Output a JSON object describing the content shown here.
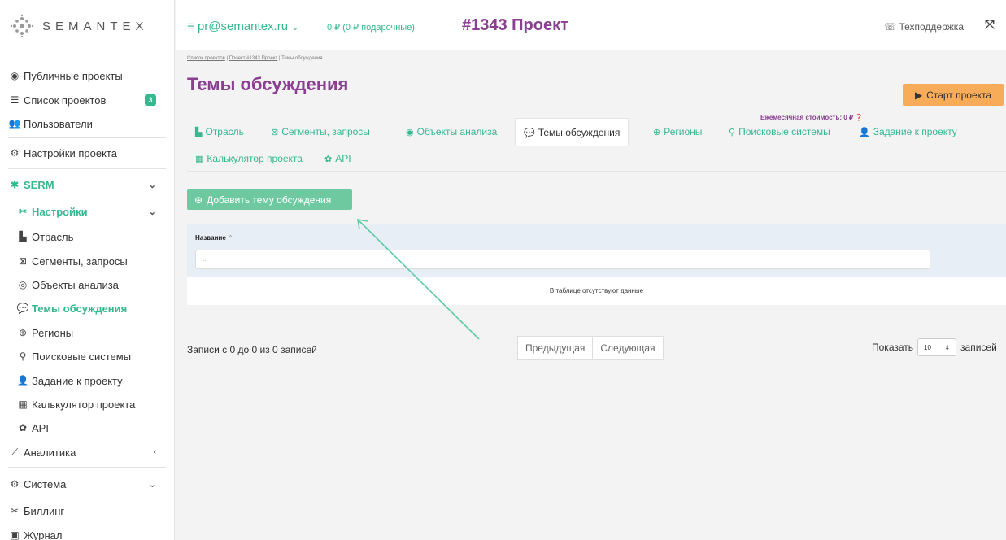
{
  "brand": {
    "name": "SEMANTEX"
  },
  "sidebar": {
    "items": [
      {
        "label": "Публичные проекты",
        "icon": "eye-icon"
      },
      {
        "label": "Список проектов",
        "icon": "list-icon",
        "badge": "3"
      },
      {
        "label": "Пользователи",
        "icon": "users-icon"
      },
      {
        "label": "Настройки проекта",
        "icon": "cogs-icon"
      },
      {
        "label": "SERM",
        "icon": "bug-icon"
      },
      {
        "label": "Настройки",
        "icon": "tools-icon"
      },
      {
        "label": "Отрасль",
        "icon": "industry-icon"
      },
      {
        "label": "Сегменты, запросы",
        "icon": "segments-icon"
      },
      {
        "label": "Объекты анализа",
        "icon": "target-icon"
      },
      {
        "label": "Темы обсуждения",
        "icon": "comments-icon"
      },
      {
        "label": "Регионы",
        "icon": "globe-icon"
      },
      {
        "label": "Поисковые системы",
        "icon": "search-icon"
      },
      {
        "label": "Задание к проекту",
        "icon": "user-edit-icon"
      },
      {
        "label": "Калькулятор проекта",
        "icon": "calculator-icon"
      },
      {
        "label": "API",
        "icon": "gear-icon"
      },
      {
        "label": "Аналитика",
        "icon": "chart-icon"
      },
      {
        "label": "Система",
        "icon": "cogs-icon"
      },
      {
        "label": "Биллинг",
        "icon": "tools-icon"
      },
      {
        "label": "Журнал",
        "icon": "journal-icon"
      }
    ]
  },
  "topbar": {
    "menu_icon": "≡",
    "user": "pr@semantex.ru",
    "balance": "0 ₽ (0 ₽ подарочные)",
    "project": "#1343 Проект",
    "support": "Техподдержка"
  },
  "breadcrumbs": [
    "Список проектов",
    "Проект #1343 Проект",
    "Темы обсуждения"
  ],
  "page": {
    "title": "Темы обсуждения",
    "monthly_cost": "Ежемесячная стоимость: 0 ₽",
    "start_button": "Старт проекта"
  },
  "tabs": [
    {
      "label": "Отрасль",
      "icon": "industry-icon"
    },
    {
      "label": "Сегменты, запросы",
      "icon": "segments-icon"
    },
    {
      "label": "Объекты анализа",
      "icon": "target-icon"
    },
    {
      "label": "Темы обсуждения",
      "icon": "comments-icon",
      "active": true
    },
    {
      "label": "Регионы",
      "icon": "globe-icon"
    },
    {
      "label": "Поисковые системы",
      "icon": "search-icon"
    },
    {
      "label": "Задание к проекту",
      "icon": "user-edit-icon"
    },
    {
      "label": "Калькулятор проекта",
      "icon": "calculator-icon"
    },
    {
      "label": "API",
      "icon": "gear-icon"
    }
  ],
  "actions": {
    "add_label": "Добавить тему обсуждения"
  },
  "table": {
    "column": "Название",
    "filter_placeholder": "...",
    "empty": "В таблице отсутствуют данные"
  },
  "pagination": {
    "records": "Записи с 0 до 0 из 0 записей",
    "prev": "Предыдущая",
    "next": "Следующая",
    "show": "Показать",
    "per_page": "10",
    "entries": "записей"
  },
  "colors": {
    "accent": "#34b88e",
    "brand": "#8a3f91",
    "start": "#f8ac59"
  }
}
